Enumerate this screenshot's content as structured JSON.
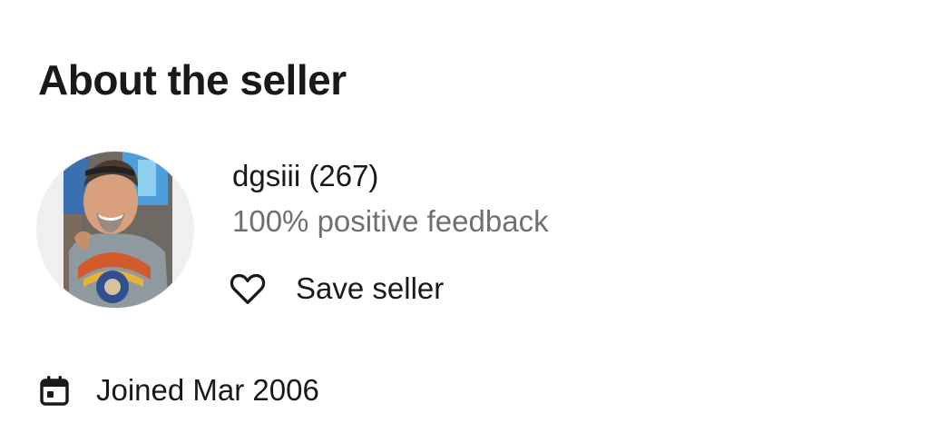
{
  "section": {
    "title": "About the seller"
  },
  "seller": {
    "name_with_score": "dgsiii (267)",
    "feedback": "100% positive feedback",
    "save_label": "Save seller",
    "joined": "Joined Mar 2006"
  },
  "icons": {
    "save": "heart-outline-icon",
    "joined": "calendar-icon"
  },
  "colors": {
    "text_primary": "#191919",
    "text_secondary": "#707070",
    "avatar_ring": "#f3f3f3"
  }
}
